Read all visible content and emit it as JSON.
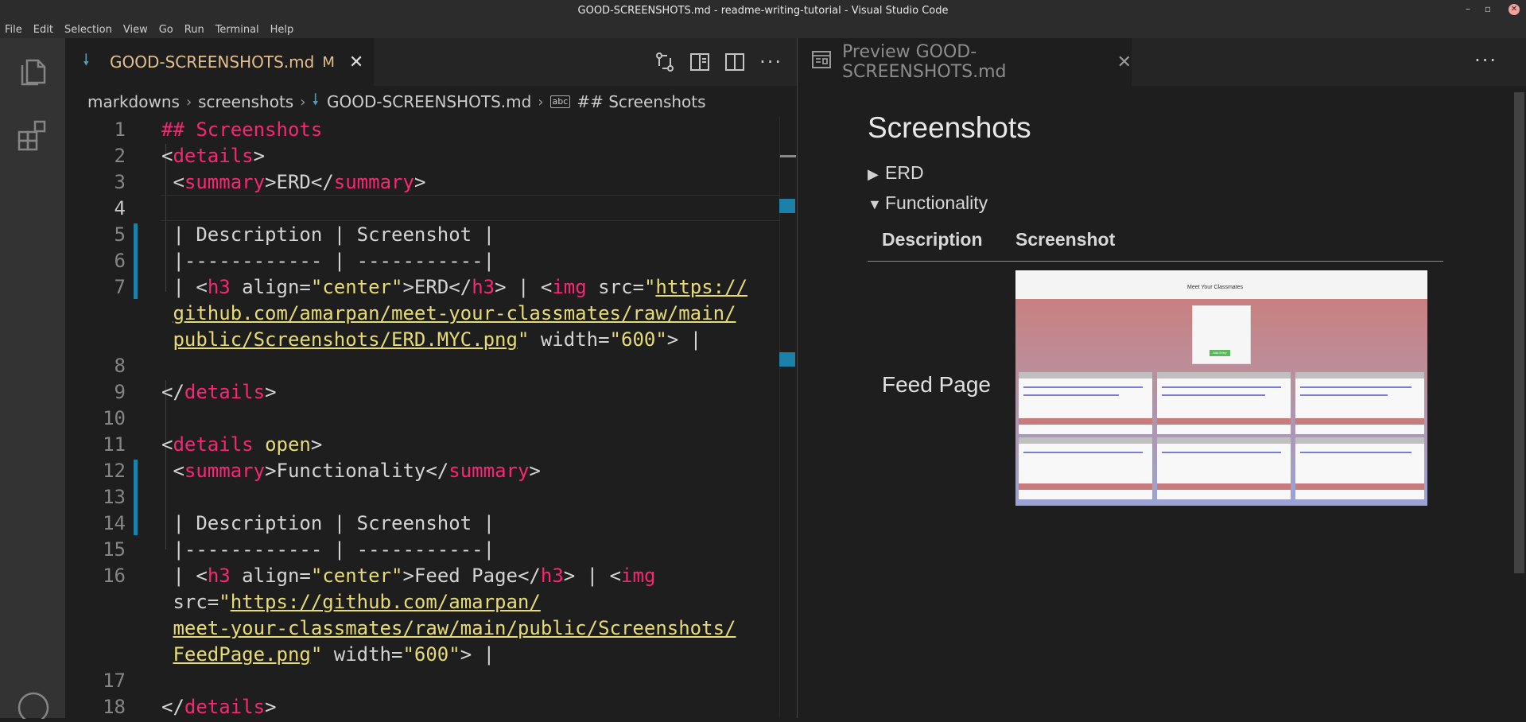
{
  "window": {
    "title": "GOOD-SCREENSHOTS.md - readme-writing-tutorial - Visual Studio Code"
  },
  "menu": [
    "File",
    "Edit",
    "Selection",
    "View",
    "Go",
    "Run",
    "Terminal",
    "Help"
  ],
  "activity_bar": {
    "icons": [
      "files-icon",
      "extensions-icon"
    ]
  },
  "editor": {
    "tab": {
      "label": "GOOD-SCREENSHOTS.md",
      "status": "M"
    },
    "breadcrumb": {
      "folder1": "markdowns",
      "folder2": "screenshots",
      "file": "GOOD-SCREENSHOTS.md",
      "symbol": "## Screenshots",
      "symbol_icon_text": "abc"
    },
    "line_numbers": [
      "1",
      "2",
      "3",
      "4",
      "5",
      "6",
      "7",
      "8",
      "9",
      "10",
      "11",
      "12",
      "13",
      "14",
      "15",
      "16",
      "17",
      "18"
    ],
    "current_line": "4",
    "lines": {
      "l1": "## Screenshots",
      "l3a": "ERD",
      "l5": "| Description | Screenshot |",
      "l6": "|------------ | -----------|",
      "l7_h3text": "ERD",
      "l7_url1": "https://",
      "l7_url2": "github.com/amarpan/meet-your-classmates/raw/main/",
      "l7_url3": "public/Screenshots/ERD.MYC.png",
      "l7_width": "\"600\"",
      "l11_open": "open",
      "l12_text": "Functionality",
      "l14": "| Description | Screenshot |",
      "l15": "|------------ | -----------|",
      "l16_h3text": "Feed Page",
      "l16_url1": "https://github.com/amarpan/",
      "l16_url2": "meet-your-classmates/raw/main/public/Screenshots/",
      "l16_url3": "FeedPage.png",
      "l16_width": "\"600\""
    }
  },
  "preview": {
    "tab_label": "Preview GOOD-SCREENSHOTS.md",
    "heading": "Screenshots",
    "details": [
      {
        "summary": "ERD",
        "open": false
      },
      {
        "summary": "Functionality",
        "open": true
      }
    ],
    "table": {
      "headers": [
        "Description",
        "Screenshot"
      ],
      "row_label": "Feed Page"
    },
    "image": {
      "banner_title": "Meet Your Classmates",
      "login_button": "Add Entry"
    }
  },
  "colors": {
    "accent_tab_text": "#e2c08d",
    "md_icon": "#519aba",
    "modified_gutter": "#1b81a8",
    "tag": "#f92672",
    "string": "#e6db74"
  }
}
